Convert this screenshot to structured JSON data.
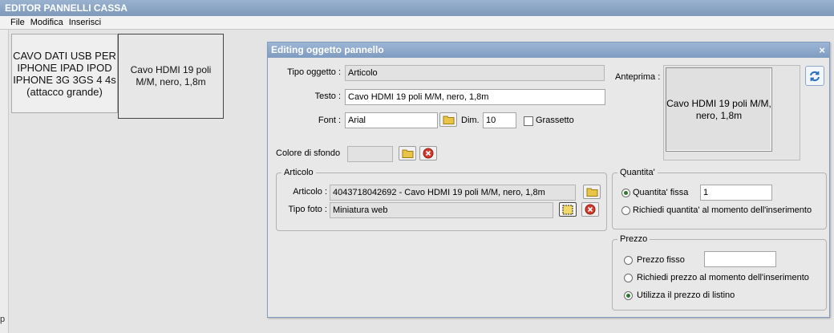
{
  "app": {
    "title": "EDITOR PANNELLI CASSA"
  },
  "menu": {
    "items": [
      "File",
      "Modifica",
      "Inserisci"
    ]
  },
  "tiles": [
    {
      "label": "CAVO DATI USB PER IPHONE IPAD IPOD IPHONE 3G 3GS 4 4s (attacco grande)"
    },
    {
      "label": "Cavo HDMI 19 poli M/M, nero, 1,8m"
    }
  ],
  "left_glyph": "p",
  "dialog": {
    "title": "Editing oggetto pannello",
    "close": "×",
    "tipo_oggetto": {
      "label": "Tipo oggetto :",
      "value": "Articolo"
    },
    "testo": {
      "label": "Testo :",
      "value": "Cavo HDMI 19 poli M/M, nero, 1,8m"
    },
    "font": {
      "label": "Font :",
      "value": "Arial",
      "dim_label": "Dim.",
      "dim_value": "10",
      "bold_label": "Grassetto",
      "bold_checked": false
    },
    "colore_sfondo": {
      "label": "Colore di sfondo",
      "value": ""
    },
    "anteprima": {
      "label": "Anteprima :",
      "text": "Cavo HDMI 19 poli M/M, nero, 1,8m"
    },
    "articolo_group": {
      "legend": "Articolo",
      "articolo_label": "Articolo :",
      "articolo_value": "4043718042692 - Cavo HDMI 19 poli M/M, nero, 1,8m",
      "tipo_foto_label": "Tipo foto :",
      "tipo_foto_value": "Miniatura web"
    },
    "quantita_group": {
      "legend": "Quantita'",
      "fissa_label": "Quantita' fissa",
      "fissa_value": "1",
      "richiedi_label": "Richiedi quantita' al momento dell'inserimento",
      "selected": "fissa"
    },
    "prezzo_group": {
      "legend": "Prezzo",
      "fisso_label": "Prezzo fisso",
      "fisso_value": "",
      "richiedi_label": "Richiedi prezzo al momento dell'inserimento",
      "listino_label": "Utilizza il prezzo di listino",
      "selected": "listino"
    }
  },
  "colors": {
    "titlebar": "#8aa3c4",
    "accent_green": "#2c7a2c",
    "delete_red": "#d33a2c",
    "folder_yellow": "#e8c547"
  }
}
